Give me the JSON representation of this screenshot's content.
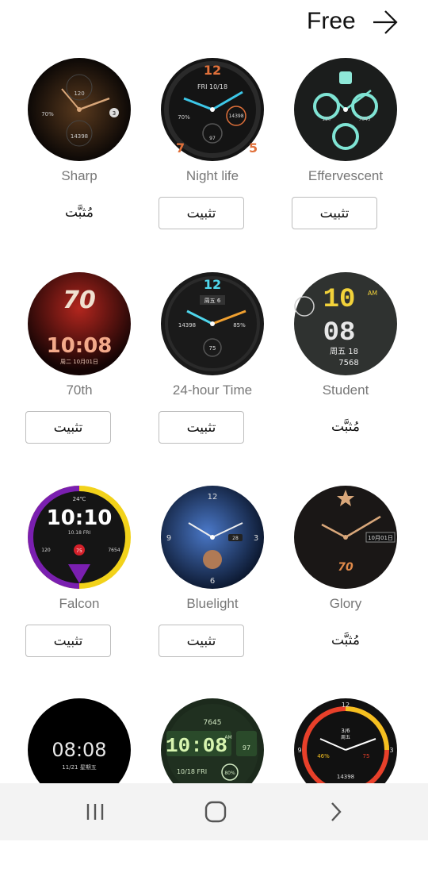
{
  "header": {
    "free_label": "Free"
  },
  "faces": [
    {
      "name": "Sharp",
      "state_label": "مُثبَّت",
      "installed": true,
      "inner": [
        "120",
        "70%",
        "3",
        "14398"
      ]
    },
    {
      "name": "Night life",
      "state_label": "تثبيت",
      "installed": false,
      "inner": [
        "FRI 10/18",
        "70%",
        "14398",
        "97"
      ]
    },
    {
      "name": "Effervescent",
      "state_label": "تثبيت",
      "installed": false,
      "inner": [
        "120",
        "7645"
      ]
    },
    {
      "name": "70th",
      "state_label": "تثبيت",
      "installed": false,
      "inner": [
        "70",
        "10:08",
        "周二 10月01日"
      ]
    },
    {
      "name": "24-hour Time",
      "state_label": "تثبيت",
      "installed": false,
      "inner": [
        "12",
        "周五 6",
        "14398",
        "85%",
        "75"
      ]
    },
    {
      "name": "Student",
      "state_label": "مُثبَّت",
      "installed": true,
      "inner": [
        "10",
        "08",
        "AM",
        "周五 18",
        "7568"
      ]
    },
    {
      "name": "Falcon",
      "state_label": "تثبيت",
      "installed": false,
      "inner": [
        "24℃",
        "10:10",
        "10.18 FRI",
        "120",
        "75",
        "7654"
      ]
    },
    {
      "name": "Bluelight",
      "state_label": "تثبيت",
      "installed": false,
      "inner": [
        "12",
        "3",
        "6",
        "9",
        "28"
      ]
    },
    {
      "name": "Glory",
      "state_label": "مُثبَّت",
      "installed": true,
      "inner": [
        "10月01日",
        "70"
      ]
    },
    {
      "name": "",
      "state_label": "",
      "installed": false,
      "inner": [
        "08:08",
        "11/21 星期五"
      ]
    },
    {
      "name": "",
      "state_label": "",
      "installed": false,
      "inner": [
        "7645",
        "10:08",
        "AM",
        "97",
        "10/18 FRI",
        "80%"
      ]
    },
    {
      "name": "",
      "state_label": "",
      "installed": false,
      "inner": [
        "12",
        "3/6",
        "周五",
        "46%",
        "75",
        "14398",
        "3",
        "9"
      ]
    }
  ],
  "colors": {
    "navbar_bg": "#f3f3f3",
    "name_text": "#777777",
    "button_border": "#bdbdbd"
  },
  "navbar": {
    "icons": [
      "recent-apps-icon",
      "home-icon",
      "back-icon"
    ]
  }
}
